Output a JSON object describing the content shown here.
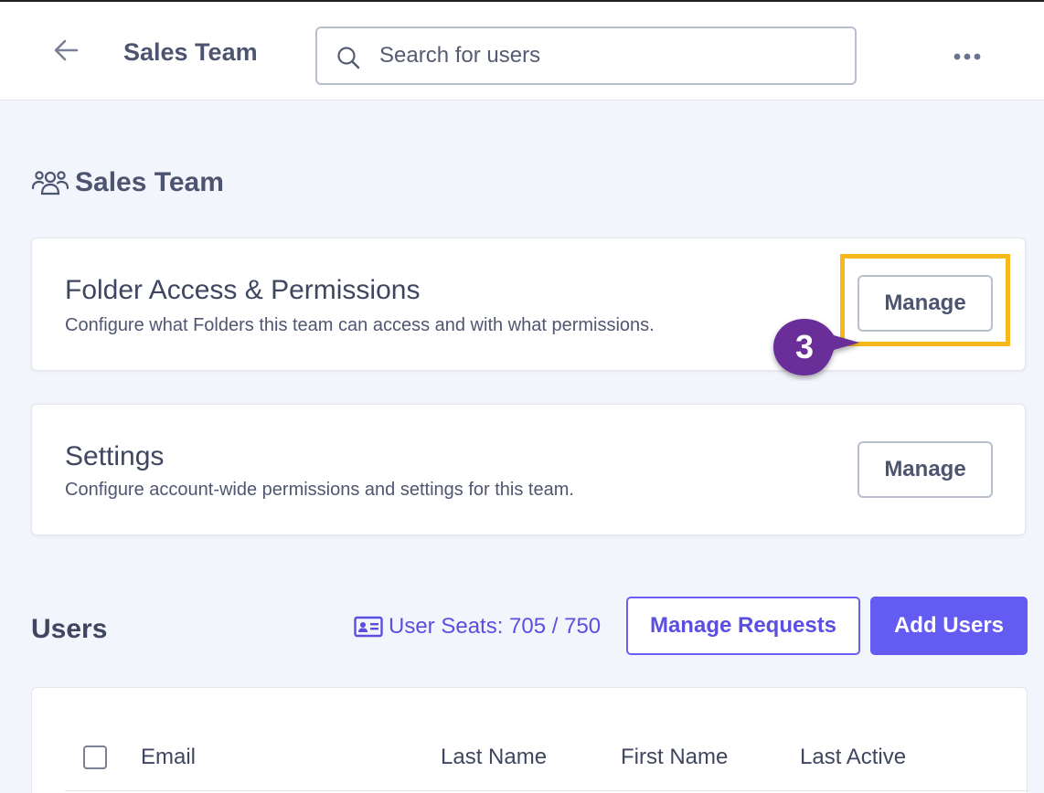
{
  "header": {
    "title": "Sales Team",
    "search_placeholder": "Search for users",
    "back_icon": "arrow-left-icon",
    "more_icon": "more-horizontal-icon"
  },
  "team": {
    "name": "Sales Team",
    "icon": "users-group-icon"
  },
  "cards": [
    {
      "title": "Folder Access & Permissions",
      "description": "Configure what Folders this team can access and with what permissions.",
      "button_label": "Manage"
    },
    {
      "title": "Settings",
      "description": "Configure account-wide permissions and settings for this team.",
      "button_label": "Manage"
    }
  ],
  "annotation": {
    "step": "3",
    "marker_color": "#6b2f98",
    "highlight_color": "#f6b81b"
  },
  "users": {
    "title": "Users",
    "seats_label": "User Seats: 705 / 750",
    "seats_icon": "id-card-icon",
    "manage_requests_label": "Manage Requests",
    "add_users_label": "Add Users",
    "columns": [
      "Email",
      "Last Name",
      "First Name",
      "Last Active"
    ]
  },
  "colors": {
    "accent": "#635bf2",
    "background": "#f2f5fb"
  }
}
